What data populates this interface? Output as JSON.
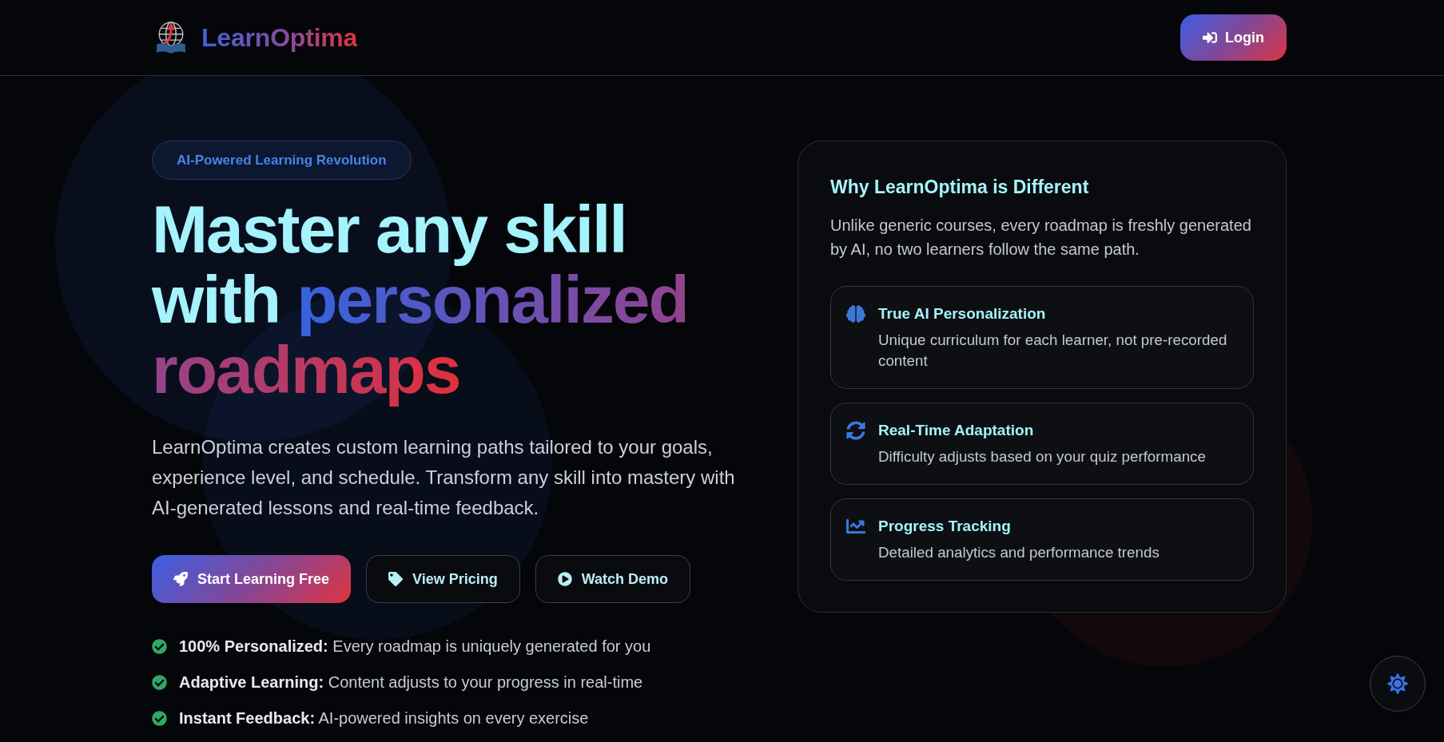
{
  "header": {
    "brand": "LearnOptima",
    "login_button": "Login"
  },
  "hero": {
    "badge": "AI-Powered Learning Revolution",
    "headline": "Master any skill with",
    "headline_highlight": "personalized roadmaps",
    "description": "LearnOptima creates custom learning paths tailored to your goals, experience level, and schedule. Transform any skill into mastery with AI-generated lessons and real-time feedback.",
    "buttons": [
      {
        "label": "Start Learning Free",
        "kind": "primary"
      },
      {
        "label": "View Pricing",
        "kind": "outline"
      },
      {
        "label": "Watch Demo",
        "kind": "outline"
      }
    ],
    "highlights": [
      "**100% Personalized:** Every roadmap is uniquely generated for you",
      "**Adaptive Learning:** Content adjusts to your progress in real-time",
      "**Instant Feedback:** AI-powered insights on every exercise"
    ]
  },
  "why_card": {
    "title": "Why LearnOptima is Different",
    "description": "Unlike generic courses, every roadmap is freshly generated by AI, no two learners follow the same path.",
    "features": [
      {
        "title": "True AI Personalization",
        "text": "Unique curriculum for each learner, not pre-recorded content"
      },
      {
        "title": "Real-Time Adaptation",
        "text": "Difficulty adjusts based on your quiz performance"
      },
      {
        "title": "Progress Tracking",
        "text": "Detailed analytics and performance trends"
      }
    ]
  }
}
